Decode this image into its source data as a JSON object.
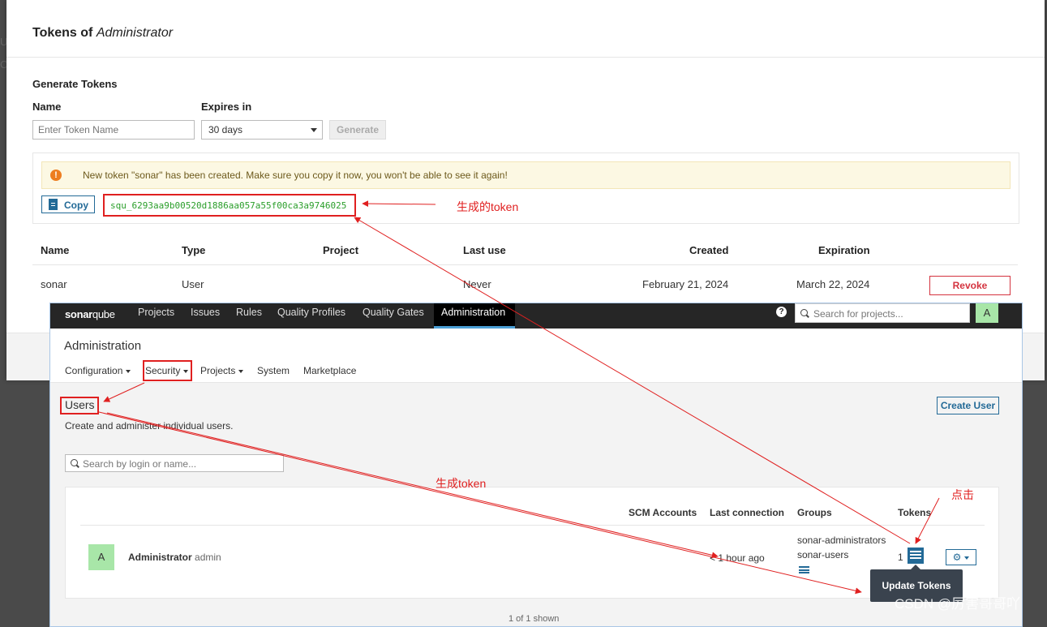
{
  "modal": {
    "title_prefix": "Tokens of",
    "title_user": "Administrator",
    "generate_heading": "Generate Tokens",
    "name_label": "Name",
    "expires_label": "Expires in",
    "name_placeholder": "Enter Token Name",
    "expires_value": "30 days",
    "generate_button": "Generate",
    "warning": "New token \"sonar\" has been created. Make sure you copy it now, you won't be able to see it again!",
    "copy_button": "Copy",
    "token_value": "squ_6293aa9b00520d1886aa057a55f00ca3a9746025",
    "table_headers": [
      "Name",
      "Type",
      "Project",
      "Last use",
      "Created",
      "Expiration"
    ],
    "row": {
      "name": "sonar",
      "type": "User",
      "project": "",
      "last_use": "Never",
      "created": "February 21, 2024",
      "expiration": "March 22, 2024",
      "revoke": "Revoke"
    }
  },
  "annotations": {
    "generated_token": "生成的token",
    "generate_token": "生成token",
    "click": "点击"
  },
  "sonarqube": {
    "logo_main": "sonar",
    "logo_sub": "qube",
    "nav": [
      "Projects",
      "Issues",
      "Rules",
      "Quality Profiles",
      "Quality Gates",
      "Administration"
    ],
    "search_placeholder": "Search for projects...",
    "avatar_letter": "A",
    "admin_title": "Administration",
    "subnav": [
      "Configuration",
      "Security",
      "Projects",
      "System",
      "Marketplace"
    ],
    "users_title": "Users",
    "users_desc": "Create and administer individual users.",
    "create_user": "Create User",
    "search_users_placeholder": "Search by login or name...",
    "columns": [
      "SCM Accounts",
      "Last connection",
      "Groups",
      "Tokens"
    ],
    "user": {
      "avatar": "A",
      "name": "Administrator",
      "login": "admin",
      "last_connection": "< 1 hour ago",
      "groups": [
        "sonar-administrators",
        "sonar-users"
      ],
      "tokens_count": "1"
    },
    "tooltip": "Update Tokens",
    "shown": "1 of 1 shown"
  },
  "watermark": "CSDN @厉害哥哥吖",
  "colors": {
    "annotation_red": "#e02020",
    "sonar_blue": "#236a97",
    "token_green": "#2a9e2a",
    "nav_dark": "#262626"
  }
}
